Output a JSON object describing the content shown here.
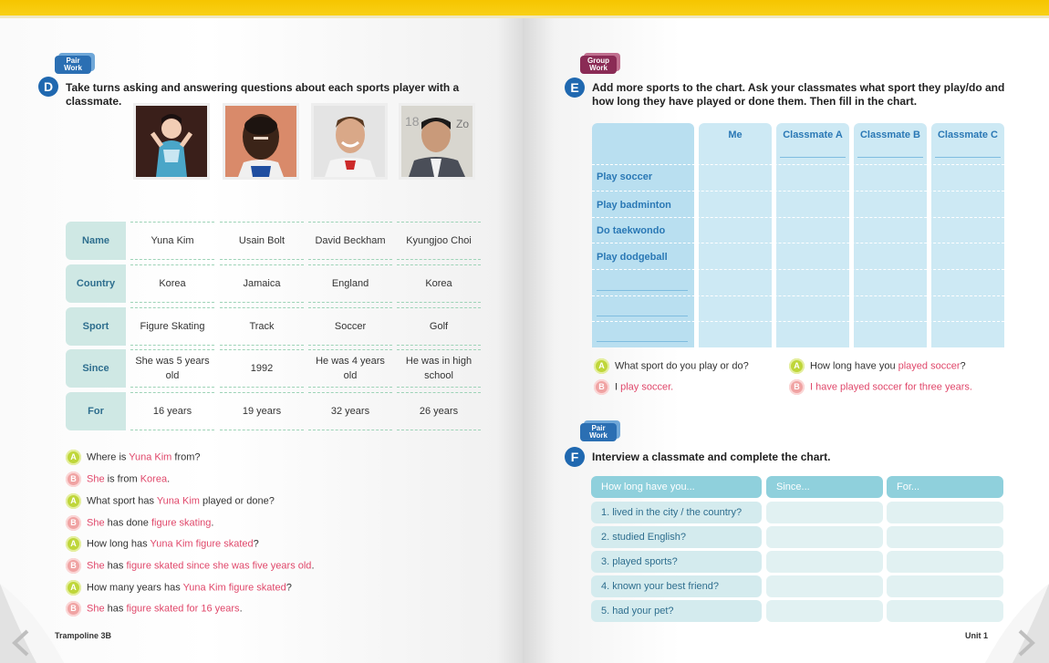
{
  "left": {
    "badge": "Pair\nWork",
    "section_letter": "D",
    "instruction": "Take turns asking and answering questions about each sports player with a classmate.",
    "row_labels": [
      "Name",
      "Country",
      "Sport",
      "Since",
      "For"
    ],
    "players": [
      {
        "name": "Yuna Kim",
        "country": "Korea",
        "sport": "Figure Skating",
        "since": "She was 5 years old",
        "for": "16 years"
      },
      {
        "name": "Usain Bolt",
        "country": "Jamaica",
        "sport": "Track",
        "since": "1992",
        "for": "19 years"
      },
      {
        "name": "David Beckham",
        "country": "England",
        "sport": "Soccer",
        "since": "He was 4 years old",
        "for": "32 years"
      },
      {
        "name": "Kyungjoo Choi",
        "country": "Korea",
        "sport": "Golf",
        "since": "He was in high school",
        "for": "26 years"
      }
    ],
    "dialogue": [
      {
        "who": "A",
        "parts": [
          "Where is ",
          "Yuna Kim",
          " from?"
        ]
      },
      {
        "who": "B",
        "parts": [
          "She",
          " is from ",
          "Korea",
          "."
        ]
      },
      {
        "who": "A",
        "parts": [
          "What sport has ",
          "Yuna Kim",
          " played or done?"
        ]
      },
      {
        "who": "B",
        "parts": [
          "She",
          " has done ",
          "figure skating",
          "."
        ]
      },
      {
        "who": "A",
        "parts": [
          "How long has ",
          "Yuna Kim figure skated",
          "?"
        ]
      },
      {
        "who": "B",
        "parts": [
          "She",
          " has ",
          "figure skated since she was five years old",
          "."
        ]
      },
      {
        "who": "A",
        "parts": [
          "How many years has ",
          "Yuna Kim figure skated",
          "?"
        ]
      },
      {
        "who": "B",
        "parts": [
          "She",
          " has ",
          "figure skated for 16 years",
          "."
        ]
      }
    ],
    "footer": "Trampoline 3B"
  },
  "right": {
    "badge_e": "Group\nWork",
    "section_e": "E",
    "instruction_e": "Add more sports to the chart. Ask your classmates what sport they play/do and how long they have played or done them. Then fill in the chart.",
    "chart_columns": [
      "Me",
      "Classmate A",
      "Classmate B",
      "Classmate C"
    ],
    "activities": [
      "Play soccer",
      "Play badminton",
      "Do taekwondo",
      "Play dodgeball"
    ],
    "ex_a1": "What sport do you play or do?",
    "ex_b1_pre": "I ",
    "ex_b1_red": "play soccer.",
    "ex_a2_pre": "How long have you ",
    "ex_a2_red": "played soccer",
    "ex_a2_post": "?",
    "ex_b2": "I have played soccer for three years.",
    "badge_f": "Pair\nWork",
    "section_f": "F",
    "instruction_f": "Interview a classmate and complete the chart.",
    "f_headers": [
      "How long have you...",
      "Since...",
      "For..."
    ],
    "f_rows": [
      "1. lived in the city / the country?",
      "2. studied English?",
      "3. played sports?",
      "4. known your best friend?",
      "5. had your pet?"
    ],
    "footer": "Unit 1"
  },
  "colors": {
    "accent_blue": "#1f68b0",
    "header_text": "#2a78b5",
    "highlight_red": "#e0476a",
    "top_bar": "#f6c500"
  }
}
